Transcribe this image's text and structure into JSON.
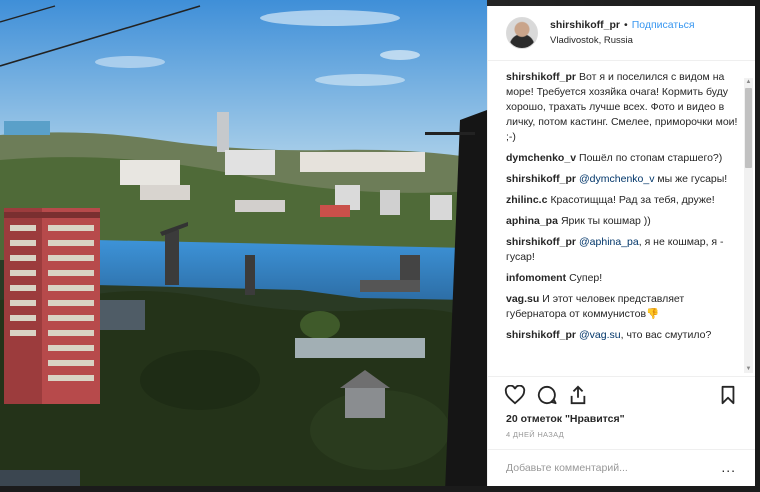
{
  "post": {
    "username": "shirshikoff_pr",
    "follow_label": "Подписаться",
    "location": "Vladivostok, Russia",
    "likes": "20 отметок \"Нравится\"",
    "time": "4 ДНЕЙ НАЗАД",
    "comment_placeholder": "Добавьте комментарий...",
    "more_label": "..."
  },
  "comments": [
    {
      "author": "shirshikoff_pr",
      "text": "Вот я и поселился с видом на море! Требуется хозяйка очага! Кормить буду хорошо, трахать лучше всех. Фото и видео в личку, потом кастинг. Смелее, приморочки мои! ;-)"
    },
    {
      "author": "dymchenko_v",
      "text": "Пошёл по стопам старшего?)"
    },
    {
      "author": "shirshikoff_pr",
      "mention": "@dymchenko_v",
      "text": "мы же гусары!"
    },
    {
      "author": "zhilinc.c",
      "text": "Красотищща! Рад за тебя, друже!"
    },
    {
      "author": "aphina_pa",
      "text": "Ярик ты кошмар ))"
    },
    {
      "author": "shirshikoff_pr",
      "mention": "@aphina_pa",
      "text": ", я не кошмар, я - гусар!"
    },
    {
      "author": "infomoment",
      "text": "Супер!"
    },
    {
      "author": "vag.su",
      "text": "И этот человек представляет губернатора от коммунистов👎"
    },
    {
      "author": "shirshikoff_pr",
      "mention": "@vag.su",
      "text": ", что вас смутило?"
    }
  ],
  "icons": {
    "like": "heart-icon",
    "comment": "comment-icon",
    "share": "share-icon",
    "save": "bookmark-icon"
  },
  "colors": {
    "link": "#3897f0",
    "mention": "#003569"
  }
}
